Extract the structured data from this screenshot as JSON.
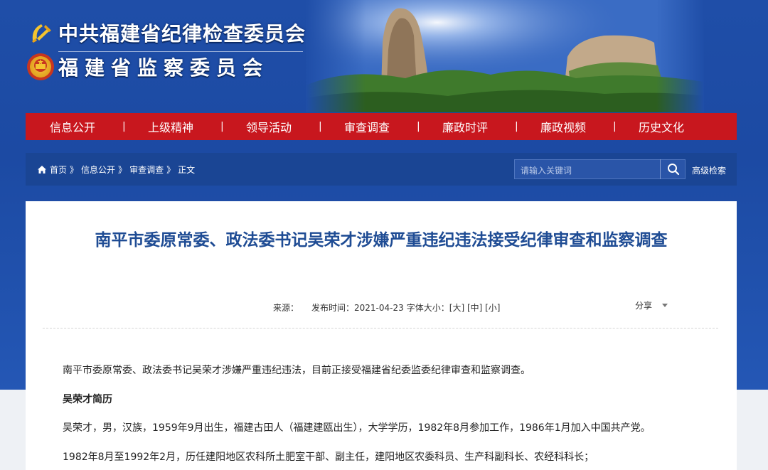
{
  "header": {
    "org_name_1": "中共福建省纪律检查委员会",
    "org_name_2": "福建省监察委员会"
  },
  "nav": {
    "items": [
      {
        "label": "信息公开"
      },
      {
        "label": "上级精神"
      },
      {
        "label": "领导活动"
      },
      {
        "label": "审查调查"
      },
      {
        "label": "廉政时评"
      },
      {
        "label": "廉政视频"
      },
      {
        "label": "历史文化"
      }
    ],
    "separator": "|"
  },
  "breadcrumb": {
    "items": [
      "首页",
      "信息公开",
      "审查调查",
      "正文"
    ],
    "sep": "》"
  },
  "search": {
    "placeholder": "请输入关键词",
    "advanced_label": "高级检索"
  },
  "article": {
    "title": "南平市委原常委、政法委书记吴荣才涉嫌严重违纪违法接受纪律审查和监察调查",
    "source_label": "来源：",
    "publish_time": "发布时间：2021-04-23",
    "font_size_label": "字体大小：[大] [中] [小]",
    "share_label": "分享",
    "paragraph_1": "南平市委原常委、政法委书记吴荣才涉嫌严重违纪违法，目前正接受福建省纪委监委纪律审查和监察调查。",
    "section_heading": "吴荣才简历",
    "paragraph_2": "吴荣才，男，汉族，1959年9月出生，福建古田人（福建建瓯出生），大学学历，1982年8月参加工作，1986年1月加入中国共产党。",
    "paragraph_3": "1982年8月至1992年2月，历任建阳地区农科所土肥室干部、副主任，建阳地区农委科员、生产科副科长、农经科科长；"
  },
  "colors": {
    "header_blue": "#1f4ea8",
    "nav_red": "#c8171e",
    "crumb_blue": "#1a4594",
    "title_blue": "#1f4c94"
  }
}
